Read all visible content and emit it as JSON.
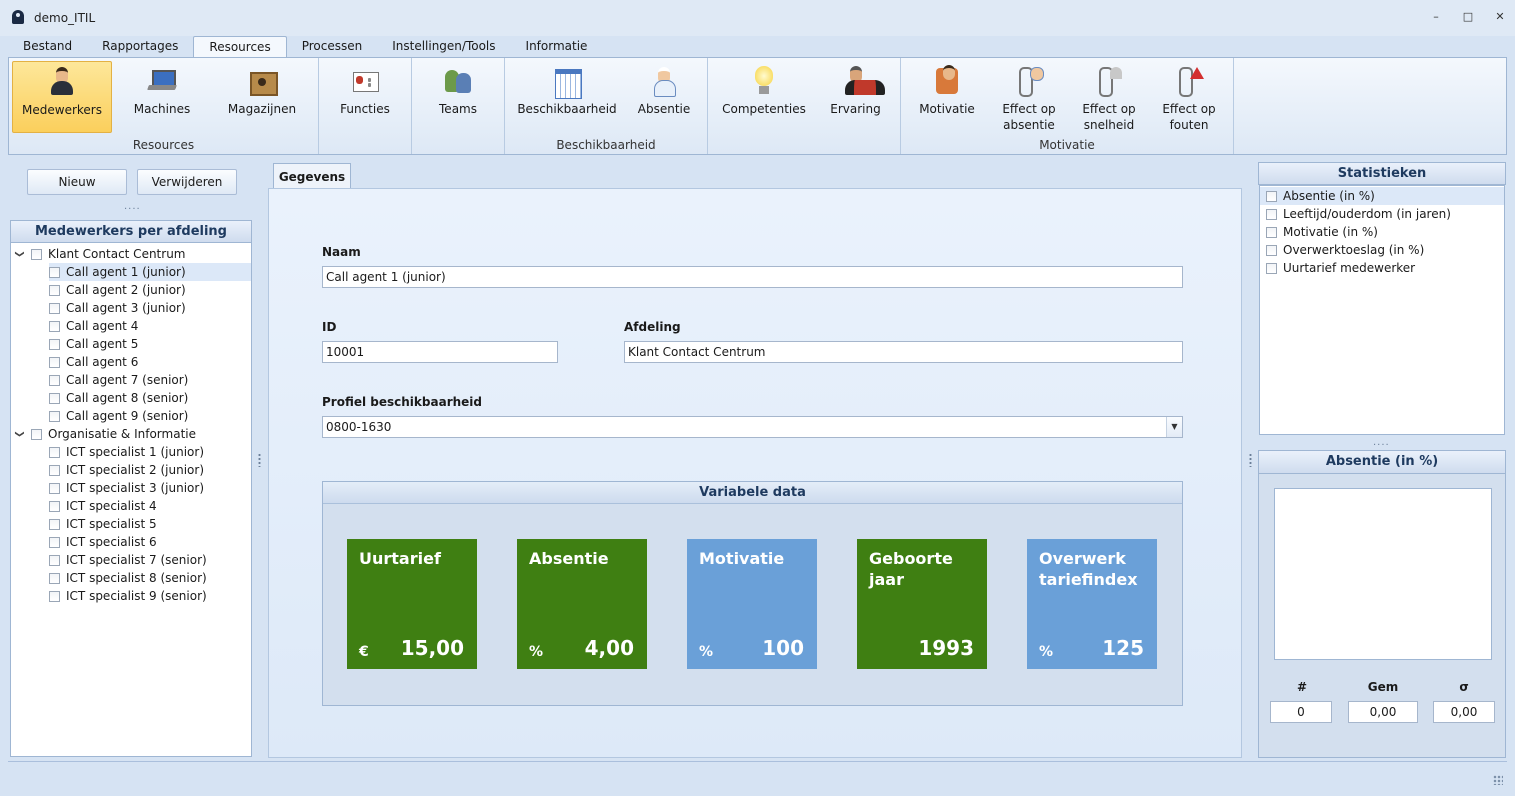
{
  "window": {
    "title": "demo_ITIL",
    "controls": [
      "–",
      "□",
      "✕"
    ]
  },
  "menu": {
    "tabs": [
      "Bestand",
      "Rapportages",
      "Resources",
      "Processen",
      "Instellingen/Tools",
      "Informatie"
    ],
    "active": "Resources"
  },
  "ribbon": {
    "groups": [
      {
        "label": "Resources",
        "buttons": [
          "Medewerkers",
          "Machines",
          "Magazijnen"
        ]
      },
      {
        "label": "",
        "buttons": [
          "Functies"
        ]
      },
      {
        "label": "",
        "buttons": [
          "Teams"
        ]
      },
      {
        "label": "Beschikbaarheid",
        "buttons": [
          "Beschikbaarheid",
          "Absentie"
        ]
      },
      {
        "label": "",
        "buttons": [
          "Competenties",
          "Ervaring"
        ]
      },
      {
        "label": "Motivatie",
        "buttons": [
          "Motivatie",
          "Effect op absentie",
          "Effect op snelheid",
          "Effect op fouten"
        ]
      }
    ],
    "active_button": "Medewerkers"
  },
  "left": {
    "new_label": "Nieuw",
    "delete_label": "Verwijderen",
    "dots": "....",
    "tree_title": "Medewerkers per afdeling",
    "departments": [
      {
        "name": "Klant Contact Centrum",
        "employees": [
          "Call agent 1 (junior)",
          "Call agent 2 (junior)",
          "Call agent 3 (junior)",
          "Call agent 4",
          "Call agent 5",
          "Call agent 6",
          "Call agent 7 (senior)",
          "Call agent 8 (senior)",
          "Call agent 9 (senior)"
        ]
      },
      {
        "name": "Organisatie & Informatie",
        "employees": [
          "ICT specialist 1 (junior)",
          "ICT specialist 2 (junior)",
          "ICT specialist 3 (junior)",
          "ICT specialist 4",
          "ICT specialist 5",
          "ICT specialist 6",
          "ICT specialist 7 (senior)",
          "ICT specialist 8 (senior)",
          "ICT specialist 9 (senior)"
        ]
      }
    ],
    "selected_employee": "Call agent 1 (junior)"
  },
  "form": {
    "tab_label": "Gegevens",
    "name_label": "Naam",
    "name_value": "Call agent 1 (junior)",
    "id_label": "ID",
    "id_value": "10001",
    "dept_label": "Afdeling",
    "dept_value": "Klant Contact Centrum",
    "profile_label": "Profiel beschikbaarheid",
    "profile_value": "0800-1630",
    "var_title": "Variabele data",
    "tiles": [
      {
        "title": "Uurtarief",
        "unit": "€",
        "value": "15,00",
        "color": "#3f7f12"
      },
      {
        "title": "Absentie",
        "unit": "%",
        "value": "4,00",
        "color": "#3f7f12"
      },
      {
        "title": "Motivatie",
        "unit": "%",
        "value": "100",
        "color": "#6aa0d8"
      },
      {
        "title": "Geboorte jaar",
        "unit": "",
        "value": "1993",
        "color": "#3f7f12"
      },
      {
        "title": "Overwerk tariefindex",
        "unit": "%",
        "value": "125",
        "color": "#6aa0d8"
      }
    ]
  },
  "right": {
    "stats_title": "Statistieken",
    "stats": [
      "Absentie (in %)",
      "Leeftijd/ouderdom (in jaren)",
      "Motivatie (in %)",
      "Overwerktoeslag (in %)",
      "Uurtarief medewerker"
    ],
    "selected_stat": "Absentie (in %)",
    "dots": "....",
    "detail_title": "Absentie (in %)",
    "count_label": "#",
    "count_value": "0",
    "mean_label": "Gem",
    "mean_value": "0,00",
    "sigma_label": "σ",
    "sigma_value": "0,00"
  }
}
